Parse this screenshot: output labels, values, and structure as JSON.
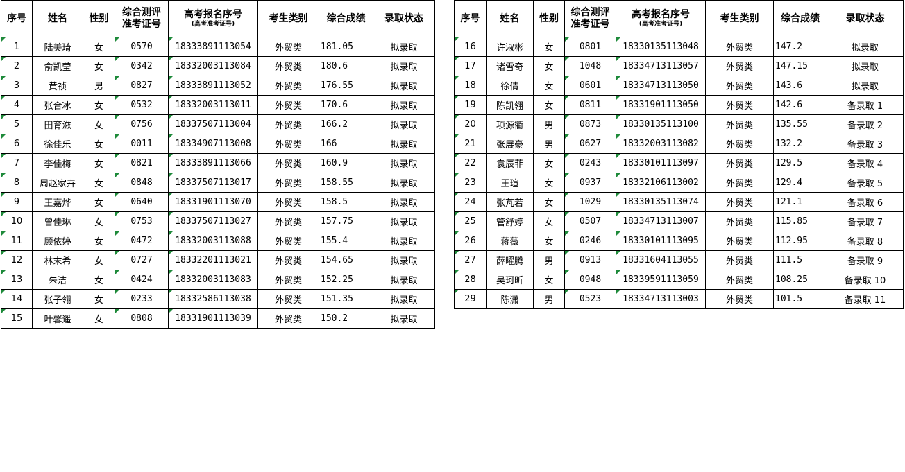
{
  "headers": {
    "seq": "序号",
    "name": "姓名",
    "gender": "性别",
    "exam_id": "综合测评\n准考证号",
    "gaokao_id": "高考报名序号",
    "gaokao_id_sub": "(高考准考证号)",
    "category": "考生类别",
    "score": "综合成绩",
    "status": "录取状态"
  },
  "left_rows": [
    {
      "seq": "1",
      "name": "陆美琦",
      "gender": "女",
      "exam_id": "0570",
      "gaokao_id": "18333891113054",
      "category": "外贸类",
      "score": "181.05",
      "status": "拟录取"
    },
    {
      "seq": "2",
      "name": "俞凯莹",
      "gender": "女",
      "exam_id": "0342",
      "gaokao_id": "18332003113084",
      "category": "外贸类",
      "score": "180.6",
      "status": "拟录取"
    },
    {
      "seq": "3",
      "name": "黄祯",
      "gender": "男",
      "exam_id": "0827",
      "gaokao_id": "18333891113052",
      "category": "外贸类",
      "score": "176.55",
      "status": "拟录取"
    },
    {
      "seq": "4",
      "name": "张合冰",
      "gender": "女",
      "exam_id": "0532",
      "gaokao_id": "18332003113011",
      "category": "外贸类",
      "score": "170.6",
      "status": "拟录取"
    },
    {
      "seq": "5",
      "name": "田育滋",
      "gender": "女",
      "exam_id": "0756",
      "gaokao_id": "18337507113004",
      "category": "外贸类",
      "score": "166.2",
      "status": "拟录取"
    },
    {
      "seq": "6",
      "name": "徐佳乐",
      "gender": "女",
      "exam_id": "0011",
      "gaokao_id": "18334907113008",
      "category": "外贸类",
      "score": "166",
      "status": "拟录取"
    },
    {
      "seq": "7",
      "name": "李佳梅",
      "gender": "女",
      "exam_id": "0821",
      "gaokao_id": "18333891113066",
      "category": "外贸类",
      "score": "160.9",
      "status": "拟录取"
    },
    {
      "seq": "8",
      "name": "周赵家卉",
      "gender": "女",
      "exam_id": "0848",
      "gaokao_id": "18337507113017",
      "category": "外贸类",
      "score": "158.55",
      "status": "拟录取"
    },
    {
      "seq": "9",
      "name": "王嘉烨",
      "gender": "女",
      "exam_id": "0640",
      "gaokao_id": "18331901113070",
      "category": "外贸类",
      "score": "158.5",
      "status": "拟录取"
    },
    {
      "seq": "10",
      "name": "曾佳琳",
      "gender": "女",
      "exam_id": "0753",
      "gaokao_id": "18337507113027",
      "category": "外贸类",
      "score": "157.75",
      "status": "拟录取"
    },
    {
      "seq": "11",
      "name": "顾依婷",
      "gender": "女",
      "exam_id": "0472",
      "gaokao_id": "18332003113088",
      "category": "外贸类",
      "score": "155.4",
      "status": "拟录取"
    },
    {
      "seq": "12",
      "name": "林末希",
      "gender": "女",
      "exam_id": "0727",
      "gaokao_id": "18332201113021",
      "category": "外贸类",
      "score": "154.65",
      "status": "拟录取"
    },
    {
      "seq": "13",
      "name": "朱洁",
      "gender": "女",
      "exam_id": "0424",
      "gaokao_id": "18332003113083",
      "category": "外贸类",
      "score": "152.25",
      "status": "拟录取"
    },
    {
      "seq": "14",
      "name": "张子翎",
      "gender": "女",
      "exam_id": "0233",
      "gaokao_id": "18332586113038",
      "category": "外贸类",
      "score": "151.35",
      "status": "拟录取"
    },
    {
      "seq": "15",
      "name": "叶馨遥",
      "gender": "女",
      "exam_id": "0808",
      "gaokao_id": "18331901113039",
      "category": "外贸类",
      "score": "150.2",
      "status": "拟录取"
    }
  ],
  "right_rows": [
    {
      "seq": "16",
      "name": "许淑彬",
      "gender": "女",
      "exam_id": "0801",
      "gaokao_id": "18330135113048",
      "category": "外贸类",
      "score": "147.2",
      "status": "拟录取"
    },
    {
      "seq": "17",
      "name": "诸雪奇",
      "gender": "女",
      "exam_id": "1048",
      "gaokao_id": "18334713113057",
      "category": "外贸类",
      "score": "147.15",
      "status": "拟录取"
    },
    {
      "seq": "18",
      "name": "徐倩",
      "gender": "女",
      "exam_id": "0601",
      "gaokao_id": "18334713113050",
      "category": "外贸类",
      "score": "143.6",
      "status": "拟录取"
    },
    {
      "seq": "19",
      "name": "陈凯翎",
      "gender": "女",
      "exam_id": "0811",
      "gaokao_id": "18331901113050",
      "category": "外贸类",
      "score": "142.6",
      "status": "备录取 1"
    },
    {
      "seq": "20",
      "name": "项源衢",
      "gender": "男",
      "exam_id": "0873",
      "gaokao_id": "18330135113100",
      "category": "外贸类",
      "score": "135.55",
      "status": "备录取 2"
    },
    {
      "seq": "21",
      "name": "张展豪",
      "gender": "男",
      "exam_id": "0627",
      "gaokao_id": "18332003113082",
      "category": "外贸类",
      "score": "132.2",
      "status": "备录取 3"
    },
    {
      "seq": "22",
      "name": "袁辰菲",
      "gender": "女",
      "exam_id": "0243",
      "gaokao_id": "18330101113097",
      "category": "外贸类",
      "score": "129.5",
      "status": "备录取 4"
    },
    {
      "seq": "23",
      "name": "王瑄",
      "gender": "女",
      "exam_id": "0937",
      "gaokao_id": "18332106113002",
      "category": "外贸类",
      "score": "129.4",
      "status": "备录取 5"
    },
    {
      "seq": "24",
      "name": "张芃若",
      "gender": "女",
      "exam_id": "1029",
      "gaokao_id": "18330135113074",
      "category": "外贸类",
      "score": "121.1",
      "status": "备录取 6"
    },
    {
      "seq": "25",
      "name": "管舒婷",
      "gender": "女",
      "exam_id": "0507",
      "gaokao_id": "18334713113007",
      "category": "外贸类",
      "score": "115.85",
      "status": "备录取 7"
    },
    {
      "seq": "26",
      "name": "蒋薇",
      "gender": "女",
      "exam_id": "0246",
      "gaokao_id": "18330101113095",
      "category": "外贸类",
      "score": "112.95",
      "status": "备录取 8"
    },
    {
      "seq": "27",
      "name": "薛曜腾",
      "gender": "男",
      "exam_id": "0913",
      "gaokao_id": "18331604113055",
      "category": "外贸类",
      "score": "111.5",
      "status": "备录取 9"
    },
    {
      "seq": "28",
      "name": "吴珂昕",
      "gender": "女",
      "exam_id": "0948",
      "gaokao_id": "18339591113059",
      "category": "外贸类",
      "score": "108.25",
      "status": "备录取 10"
    },
    {
      "seq": "29",
      "name": "陈潇",
      "gender": "男",
      "exam_id": "0523",
      "gaokao_id": "18334713113003",
      "category": "外贸类",
      "score": "101.5",
      "status": "备录取 11"
    }
  ],
  "colors": {
    "cell_marker": "#1e8a3a",
    "border": "#000000"
  }
}
